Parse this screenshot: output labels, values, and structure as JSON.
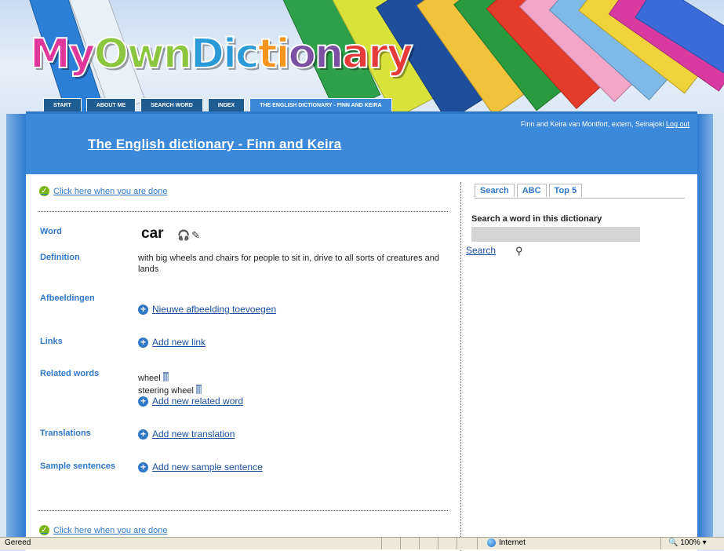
{
  "logo": {
    "parts": [
      "My",
      "Own",
      "Dic",
      "ti",
      "on",
      "ary"
    ],
    "alt": "MyOwnDictionary"
  },
  "nav": {
    "tabs": [
      {
        "label": "START"
      },
      {
        "label": "ABOUT ME"
      },
      {
        "label": "SEARCH WORD"
      },
      {
        "label": "INDEX"
      },
      {
        "label": "THE ENGLISH DICTIONARY - FINN AND KEIRA",
        "active": true
      }
    ]
  },
  "header": {
    "user_text": "Finn and Keira van Montfort, extern, Seinajoki",
    "logout_label": "Log out",
    "title": "The English dictionary - Finn and Keira"
  },
  "entry": {
    "done_label": "Click here when you are done",
    "word_label": "Word",
    "word": "car",
    "word_icons": "🎧✎",
    "definition_label": "Definition",
    "definition": "with big wheels and chairs for people to sit in, drive to all sorts of creatures and lands",
    "images_label": "Afbeeldingen",
    "add_image": "Nieuwe afbeelding toevoegen",
    "links_label": "Links",
    "add_link": "Add new link",
    "related_label": "Related words",
    "related_words": [
      "wheel",
      "steering wheel"
    ],
    "add_related": "Add new related word",
    "translations_label": "Translations",
    "add_translation": "Add new translation",
    "sentences_label": "Sample sentences",
    "add_sentence": "Add new sample sentence"
  },
  "sidebar": {
    "tabs": [
      {
        "label": "Search"
      },
      {
        "label": "ABC"
      },
      {
        "label": "Top 5"
      }
    ],
    "heading": "Search a word in this dictionary",
    "input_value": "",
    "search_link": "Search"
  },
  "statusbar": {
    "left": "Gereed",
    "zone": "Internet",
    "zoom": "100%"
  },
  "colors": {
    "header_blue": "#3d89d9",
    "nav_blue": "#1f5c92",
    "link_blue": "#2f77c7",
    "check_green": "#7cb518"
  }
}
